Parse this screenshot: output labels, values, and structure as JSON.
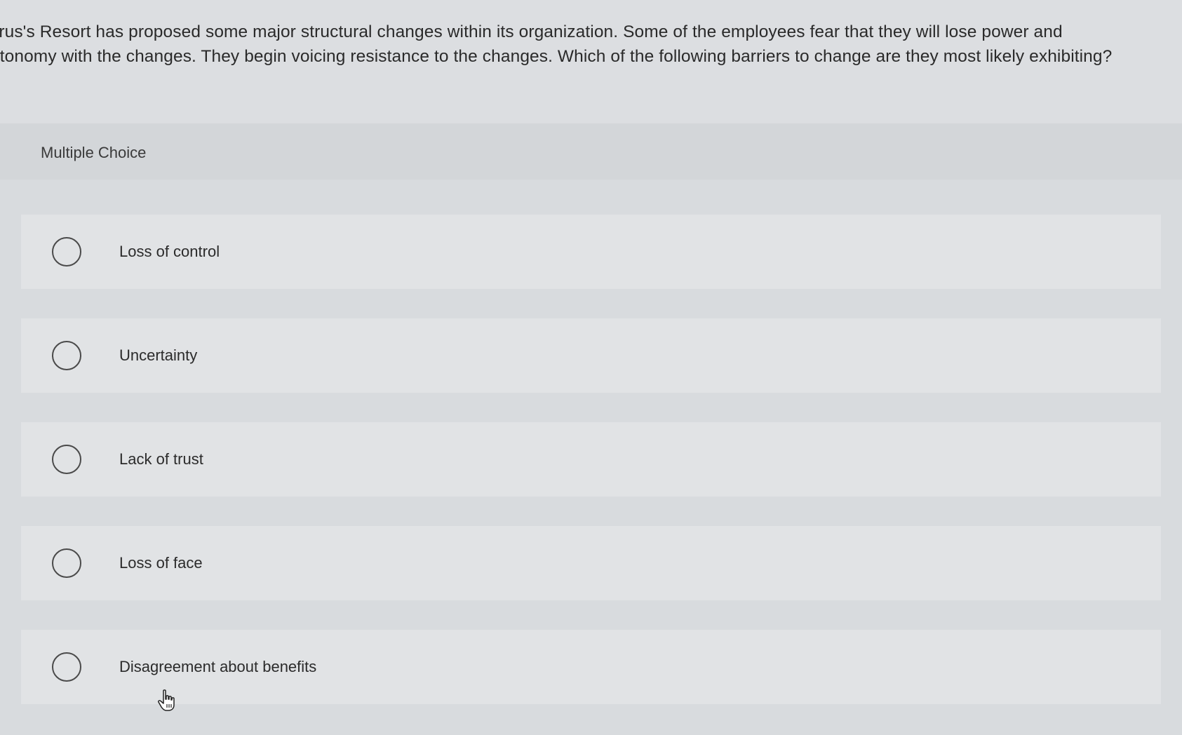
{
  "question": {
    "line1": "yrus's Resort has proposed some major structural changes within its organization. Some of the employees fear that they will lose power and",
    "line2": "utonomy with the changes. They begin voicing resistance to the changes. Which of the following barriers to change are they most likely exhibiting?"
  },
  "multiple_choice": {
    "title": "Multiple Choice",
    "options": [
      {
        "label": "Loss of control",
        "selected": false
      },
      {
        "label": "Uncertainty",
        "selected": false
      },
      {
        "label": "Lack of trust",
        "selected": false
      },
      {
        "label": "Loss of face",
        "selected": false
      },
      {
        "label": "Disagreement about benefits",
        "selected": false
      }
    ]
  },
  "icons": {
    "radio": "radio-unchecked-icon",
    "cursor": "hand-pointer-cursor-icon"
  }
}
